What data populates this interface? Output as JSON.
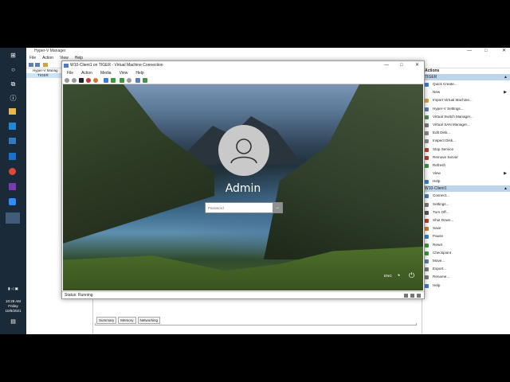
{
  "hyperv": {
    "title": "Hyper-V Manager",
    "menu": [
      "File",
      "Action",
      "View",
      "Help"
    ],
    "tree": [
      "Hyper-V Manag",
      "TIGER"
    ],
    "bottom_tabs": [
      "Summary",
      "Memory",
      "Networking"
    ]
  },
  "actions": {
    "header": "Actions",
    "host_section": "TIGER",
    "host_items": [
      {
        "label": "Quick Create...",
        "icon_color": "#3b7ed6",
        "submenu": false
      },
      {
        "label": "New",
        "icon_color": "#ffffff",
        "submenu": true
      },
      {
        "label": "Import Virtual Machine...",
        "icon_color": "#d9a13a",
        "submenu": false
      },
      {
        "label": "Hyper-V Settings...",
        "icon_color": "#5b7fb6",
        "submenu": false
      },
      {
        "label": "Virtual Switch Manager...",
        "icon_color": "#4c8e4c",
        "submenu": false
      },
      {
        "label": "Virtual SAN Manager...",
        "icon_color": "#7a7a7a",
        "submenu": false
      },
      {
        "label": "Edit Disk...",
        "icon_color": "#8a8a8a",
        "submenu": false
      },
      {
        "label": "Inspect Disk...",
        "icon_color": "#8a8a8a",
        "submenu": false
      },
      {
        "label": "Stop Service",
        "icon_color": "#c0392b",
        "submenu": false
      },
      {
        "label": "Remove Server",
        "icon_color": "#c0392b",
        "submenu": false
      },
      {
        "label": "Refresh",
        "icon_color": "#3c9a3c",
        "submenu": false
      },
      {
        "label": "View",
        "icon_color": "#ffffff",
        "submenu": true
      },
      {
        "label": "Help",
        "icon_color": "#3b7ed6",
        "submenu": false
      }
    ],
    "vm_section": "W10-Client1",
    "vm_items": [
      {
        "label": "Connect...",
        "icon_color": "#4a7abf"
      },
      {
        "label": "Settings...",
        "icon_color": "#7a7a7a"
      },
      {
        "label": "Turn Off...",
        "icon_color": "#555555"
      },
      {
        "label": "Shut Down...",
        "icon_color": "#c0392b"
      },
      {
        "label": "Save",
        "icon_color": "#d4762a"
      },
      {
        "label": "Pause",
        "icon_color": "#3b7ed6"
      },
      {
        "label": "Reset",
        "icon_color": "#3c9a3c"
      },
      {
        "label": "Checkpoint",
        "icon_color": "#3c9a3c"
      },
      {
        "label": "Move...",
        "icon_color": "#5b7fb6"
      },
      {
        "label": "Export...",
        "icon_color": "#7a7a7a"
      },
      {
        "label": "Rename...",
        "icon_color": "#7a7a7a"
      },
      {
        "label": "Help",
        "icon_color": "#3b7ed6"
      }
    ]
  },
  "vm_window": {
    "title": "W10-Client1 on TIGER - Virtual Machine Connection",
    "menu": [
      "File",
      "Action",
      "Media",
      "View",
      "Help"
    ],
    "user_name": "Admin",
    "password_placeholder": "Password",
    "language": "ENG",
    "status": "Status: Running"
  },
  "taskbar": {
    "icons": [
      "windows-start-icon",
      "search-icon",
      "task-view-icon",
      "file-explorer-icon",
      "store-icon",
      "mail-icon",
      "network-icon",
      "chrome-icon",
      "onenote-icon",
      "zoom-icon",
      "hyperv-icon"
    ],
    "time": "10:28 AM",
    "day": "Friday",
    "date": "10/8/2021"
  }
}
